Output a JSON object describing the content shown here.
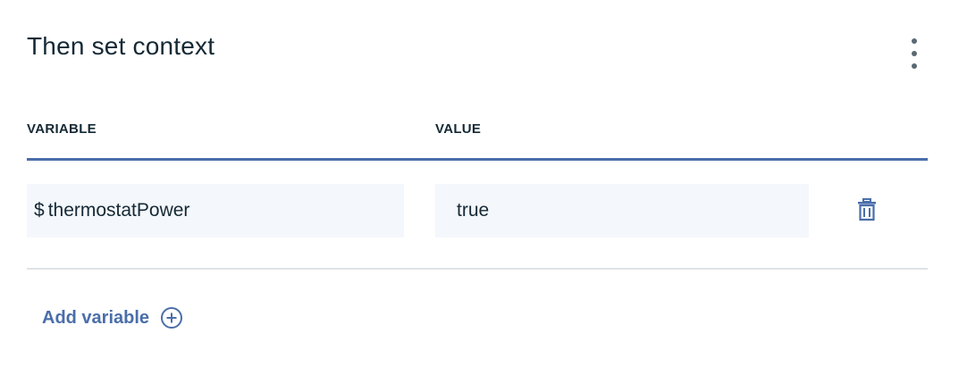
{
  "title": "Then set context",
  "icons": {
    "overflow": "overflow-menu-vertical-icon",
    "delete": "trash-icon",
    "add": "add-circle-icon"
  },
  "table": {
    "headers": {
      "variable": "VARIABLE",
      "value": "VALUE"
    },
    "rows": [
      {
        "prefix": "$",
        "variable": "thermostatPower",
        "value": "true"
      }
    ]
  },
  "add_variable_label": "Add variable",
  "colors": {
    "accent": "#4a6ea9",
    "text": "#152935",
    "field_bg": "#f4f7fb",
    "divider": "#dfe3e6"
  }
}
